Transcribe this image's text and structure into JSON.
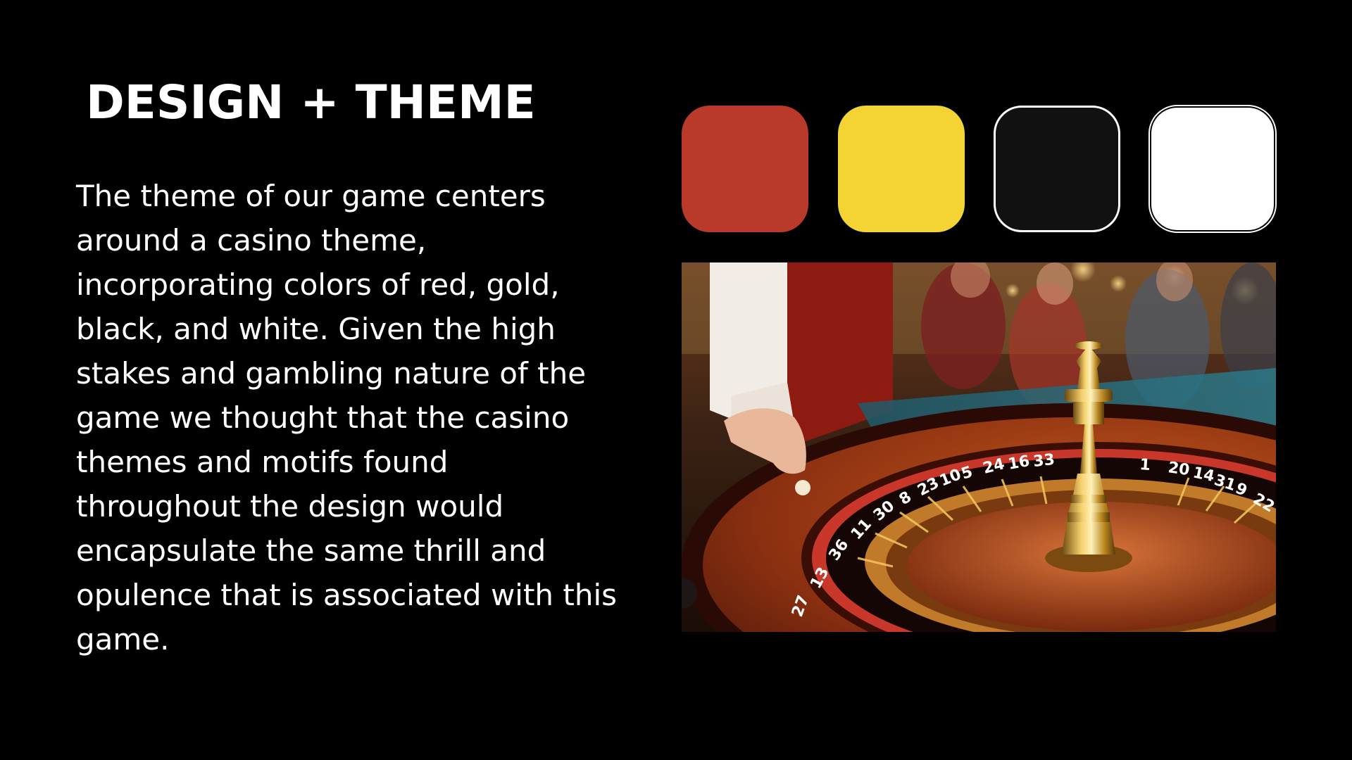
{
  "slide": {
    "title": "DESIGN + THEME",
    "body": "The theme of our game centers\naround a casino theme,\nincorporating colors of red, gold,\nblack, and white. Given the high\nstakes and gambling nature of the\ngame we thought that the casino\nthemes and motifs found\nthroughout the design would\nencapsulate the same thrill and\nopulence that is associated with this\ngame."
  },
  "palette": [
    {
      "name": "red",
      "color": "#b93a2b"
    },
    {
      "name": "gold",
      "color": "#f4d433"
    },
    {
      "name": "black",
      "color": "#111111"
    },
    {
      "name": "white",
      "color": "#ffffff"
    }
  ],
  "photo": {
    "subject": "roulette-wheel-photo",
    "wheel_numbers": [
      "27",
      "13",
      "36",
      "11",
      "30",
      "8",
      "23",
      "10",
      "5",
      "24",
      "16",
      "33",
      "1",
      "20",
      "14",
      "31",
      "9",
      "22"
    ]
  }
}
